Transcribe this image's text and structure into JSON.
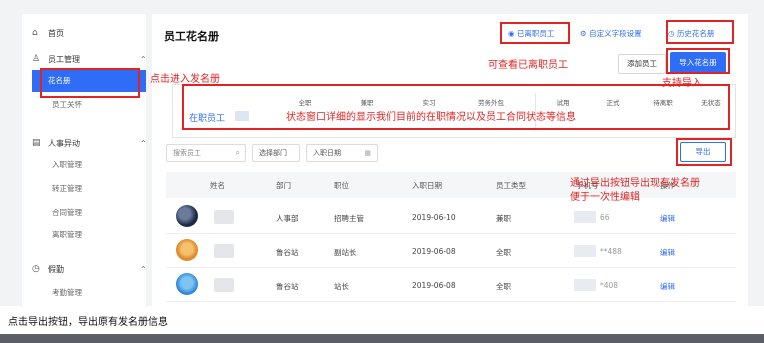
{
  "sidebar": {
    "home": {
      "icon": "home-icon",
      "label": "首页"
    },
    "staff_mgmt": {
      "icon": "user-icon",
      "label": "员工管理",
      "items": [
        "花名册",
        "员工关怀"
      ]
    },
    "hr_changes": {
      "icon": "document-icon",
      "label": "人事异动",
      "items": [
        "入职管理",
        "转正管理",
        "合同管理",
        "离职管理"
      ]
    },
    "leave": {
      "icon": "clock-icon",
      "label": "假勤",
      "items": [
        "考勤管理"
      ]
    }
  },
  "header": {
    "title": "员工花名册",
    "departed_link": "已离职员工",
    "custom_fields_link": "自定义字段设置",
    "history_link": "历史花名册",
    "add_button": "添加员工",
    "import_button": "导入花名册"
  },
  "status": {
    "label": "在职员工",
    "columns": [
      "全职",
      "兼职",
      "实习",
      "劳务外包",
      "试用",
      "正式",
      "待离职",
      "无状态"
    ]
  },
  "filters": {
    "search_placeholder": "搜索员工",
    "dept_select": "选择部门",
    "date_select": "入职日期",
    "export_button": "导出"
  },
  "table": {
    "columns": [
      "姓名",
      "部门",
      "职位",
      "入职日期",
      "员工类型",
      "手机号",
      "操作"
    ],
    "rows": [
      {
        "dept": "人事部",
        "position": "招聘主管",
        "date": "2019-06-10",
        "type": "兼职",
        "phone": "66",
        "action": "编辑"
      },
      {
        "dept": "鲁谷站",
        "position": "副站长",
        "date": "2019-06-08",
        "type": "全职",
        "phone": "**488",
        "action": "编辑"
      },
      {
        "dept": "鲁谷站",
        "position": "站长",
        "date": "2019-06-08",
        "type": "全职",
        "phone": "*408",
        "action": "编辑"
      }
    ]
  },
  "annotations": {
    "enter_roster": "点击进入发名册",
    "view_departed": "可查看已离职员工",
    "support_import": "支持导入",
    "status_detail": "状态窗口详细的显示我们目前的在职情况以及员工合同状态等信息",
    "export_line1": "通过导出按钮导出现有发名册",
    "export_line2": "便于一次性编辑"
  },
  "caption": "点击导出按钮，导出原有发名册信息",
  "colors": {
    "accent": "#2f6df6",
    "annotation": "#e02424"
  }
}
